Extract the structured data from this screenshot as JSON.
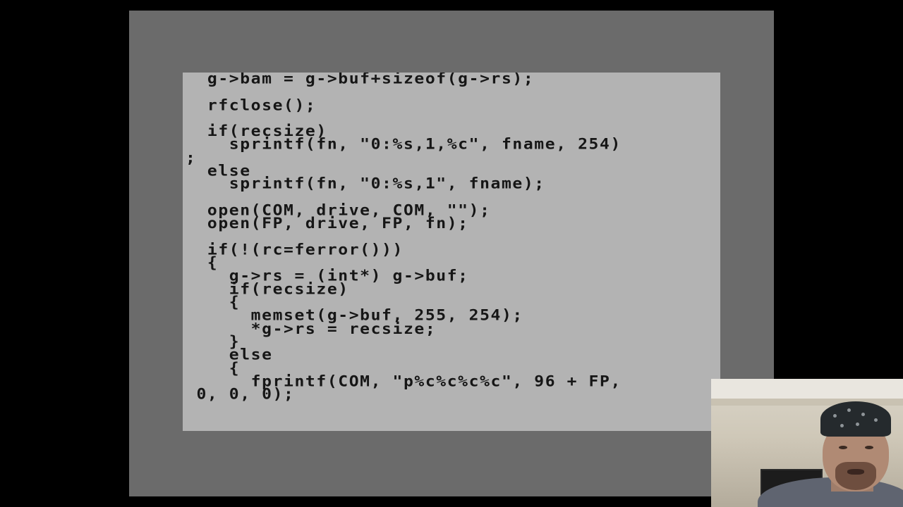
{
  "screen": {
    "background": "#b3b3b3",
    "text_color": "#161616",
    "border_color": "#6b6b6b",
    "code_lines": [
      "  g->bam = g->buf+sizeof(g->rs);",
      "",
      "  rfclose();",
      "",
      "  if(recsize)",
      "    sprintf(fn, \"0:%s,1,%c\", fname, 254)",
      ";",
      "  else",
      "    sprintf(fn, \"0:%s,1\", fname);",
      "",
      "  open(COM, drive, COM, \"\");",
      "  open(FP, drive, FP, fn);",
      "",
      "  if(!(rc=ferror()))",
      "  {",
      "    g->rs = (int*) g->buf;",
      "    if(recsize)",
      "    {",
      "      memset(g->buf, 255, 254);",
      "      *g->rs = recsize;",
      "    }",
      "    else",
      "    {",
      "      fprintf(COM, \"p%c%c%c%c\", 96 + FP,",
      " 0, 0, 0);"
    ]
  },
  "webcam": {
    "label": "webcam-feed"
  }
}
